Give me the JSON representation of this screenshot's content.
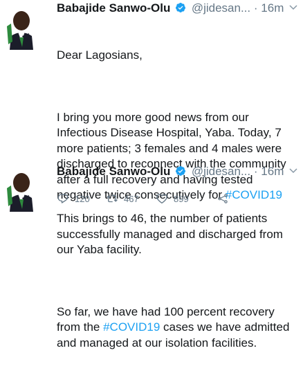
{
  "tweets": [
    {
      "author_name": "Babajide Sanwo-Olu",
      "handle": "@jidesan...",
      "separator": "·",
      "time": "16m",
      "paragraphs": [
        [
          {
            "t": "Dear Lagosians,"
          }
        ],
        [
          {
            "t": "I bring you more good news from our Infectious Disease Hospital, Yaba. Today, 7 more patients; 3 females and 4 males were discharged to reconnect with the community after a full recovery and having tested negative twice consecutively for "
          },
          {
            "t": "#COVID19",
            "tag": true
          }
        ]
      ],
      "replies": "120",
      "retweets": "467",
      "likes": "899"
    },
    {
      "author_name": "Babajide Sanwo-Olu",
      "handle": "@jidesan...",
      "separator": "·",
      "time": "16m",
      "paragraphs": [
        [
          {
            "t": "This brings to 46, the number of patients successfully managed and discharged from our Yaba facility."
          }
        ],
        [
          {
            "t": "So far, we have had 100 percent recovery from the "
          },
          {
            "t": "#COVID19",
            "tag": true
          },
          {
            "t": " cases we have admitted and managed at our isolation facilities."
          }
        ]
      ]
    }
  ],
  "colors": {
    "text": "#14171a",
    "muted": "#657786",
    "link": "#1da1f2",
    "verified": "#1da1f2"
  },
  "icons": {
    "verified": "verified-badge-icon",
    "chevron": "chevron-down-icon",
    "reply": "reply-icon",
    "retweet": "retweet-icon",
    "like": "heart-icon",
    "share": "share-icon"
  }
}
